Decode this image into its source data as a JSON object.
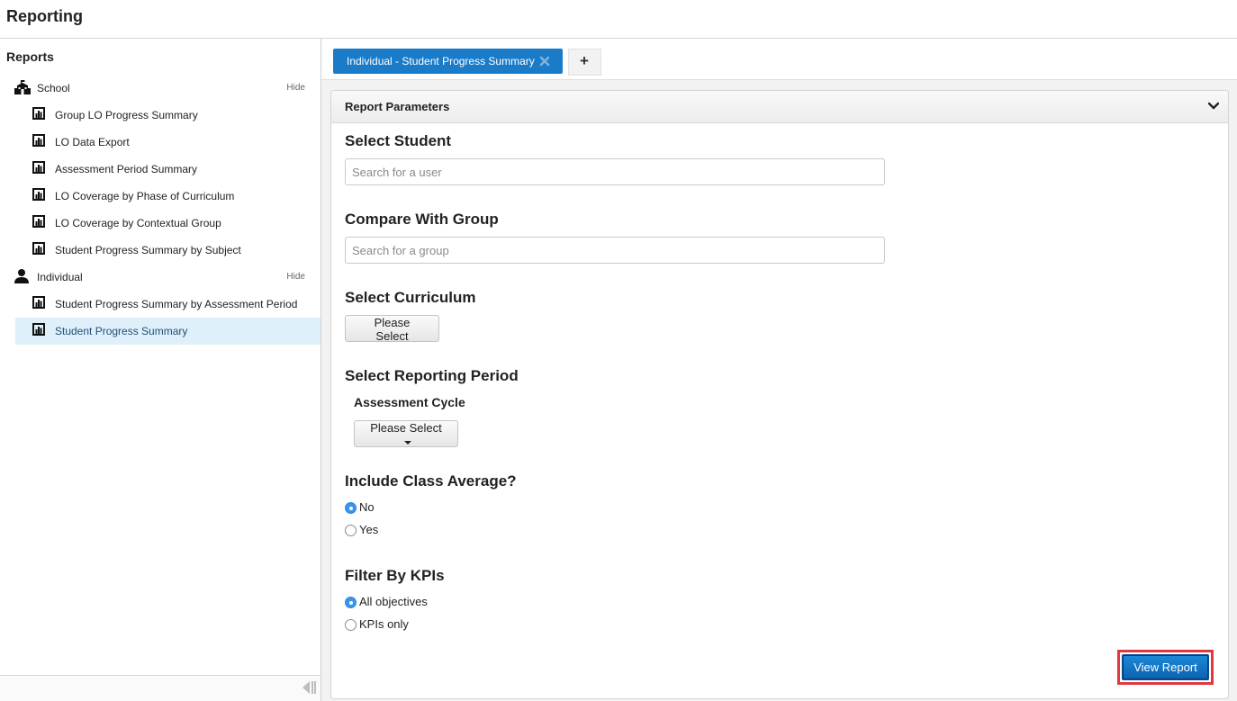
{
  "app": {
    "title": "Reporting"
  },
  "sidebar": {
    "heading": "Reports",
    "groups": [
      {
        "label": "School",
        "hide_label": "Hide",
        "icon": "school-icon"
      },
      {
        "label": "Individual",
        "hide_label": "Hide",
        "icon": "person-icon"
      }
    ],
    "school_reports": [
      {
        "label": "Group LO Progress Summary",
        "icon": "report-icon"
      },
      {
        "label": "LO Data Export",
        "icon": "report-icon"
      },
      {
        "label": "Assessment Period Summary",
        "icon": "report-icon"
      },
      {
        "label": "LO Coverage by Phase of Curriculum",
        "icon": "report-icon"
      },
      {
        "label": "LO Coverage by Contextual Group",
        "icon": "report-icon"
      },
      {
        "label": "Student Progress Summary by Subject",
        "icon": "report-icon"
      }
    ],
    "individual_reports": [
      {
        "label": "Student Progress Summary by Assessment Period",
        "icon": "report-icon"
      },
      {
        "label": "Student Progress Summary",
        "icon": "report-icon",
        "active": true
      }
    ]
  },
  "tabs": {
    "active_label": "Individual - Student Progress Summary",
    "add_label": "+"
  },
  "panel": {
    "title": "Report Parameters",
    "select_student": {
      "title": "Select Student",
      "placeholder": "Search for a user",
      "value": ""
    },
    "compare_group": {
      "title": "Compare With Group",
      "placeholder": "Search for a group",
      "value": ""
    },
    "curriculum": {
      "title": "Select Curriculum",
      "button": "Please Select"
    },
    "reporting_period": {
      "title": "Select Reporting Period",
      "subtitle": "Assessment Cycle",
      "button": "Please Select"
    },
    "class_average": {
      "title": "Include Class Average?",
      "options": [
        {
          "label": "No",
          "checked": true
        },
        {
          "label": "Yes",
          "checked": false
        }
      ]
    },
    "kpis": {
      "title": "Filter By KPIs",
      "options": [
        {
          "label": "All objectives",
          "checked": true
        },
        {
          "label": "KPIs only",
          "checked": false
        }
      ]
    },
    "view_button": "View Report"
  },
  "colors": {
    "accent": "#1a7bc9",
    "active_item_bg": "#dff0fb",
    "highlight": "#e2373f"
  }
}
